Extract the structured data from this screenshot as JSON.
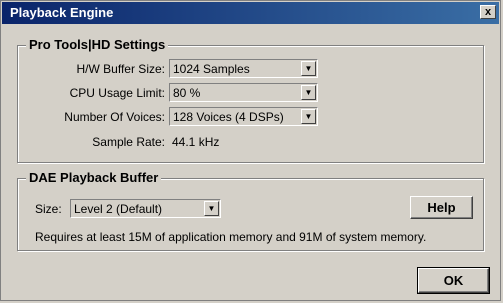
{
  "window": {
    "title": "Playback Engine",
    "close_glyph": "x",
    "close_icon": "close-icon"
  },
  "settings": {
    "title": "Pro Tools|HD Settings",
    "hw_buffer_label": "H/W Buffer Size:",
    "hw_buffer_value": "1024 Samples",
    "cpu_label": "CPU Usage Limit:",
    "cpu_value": "80 %",
    "voices_label": "Number Of Voices:",
    "voices_value": "128 Voices (4 DSPs)",
    "sample_rate_label": "Sample Rate:",
    "sample_rate_value": "44.1 kHz",
    "dropdown_icon": "chevron-down-icon"
  },
  "dae": {
    "title": "DAE Playback Buffer",
    "size_label": "Size:",
    "size_value": "Level 2 (Default)",
    "help_label": "Help",
    "note": "Requires at least 15M of application memory and 91M of system memory."
  },
  "footer": {
    "ok_label": "OK"
  },
  "colors": {
    "titlebar_start": "#0a246a",
    "titlebar_end": "#3a6ea5",
    "face": "#d4d0c8"
  }
}
